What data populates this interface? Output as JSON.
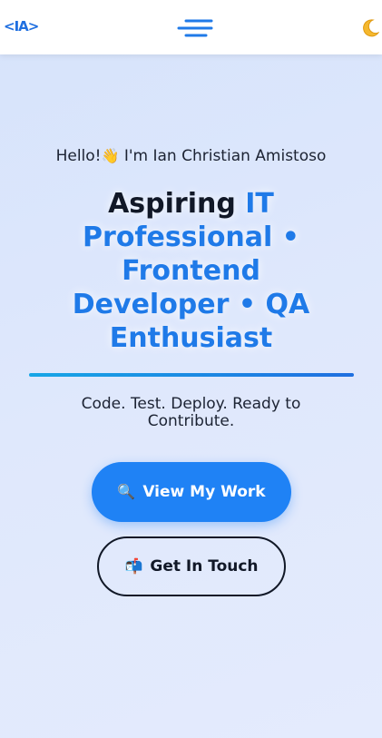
{
  "header": {
    "logo_text": "<IA>",
    "menu_icon": "menu-icon",
    "theme_icon": "moon-icon"
  },
  "hero": {
    "greeting_prefix": "Hello!",
    "greeting_emoji": "👋",
    "greeting_name": "I'm Ian Christian Amistoso",
    "headline_plain": "Aspiring ",
    "headline_accent_1": "IT Professional",
    "headline_accent_2": "• Frontend Developer • QA Enthusiast",
    "tagline": "Code. Test. Deploy. Ready to Contribute."
  },
  "buttons": {
    "primary_icon": "🔍",
    "primary_label": "View My Work",
    "secondary_icon": "📬",
    "secondary_label": "Get In Touch"
  },
  "colors": {
    "accent": "#1f7ae8",
    "primary_button": "#1f82f5",
    "text_dark": "#111827"
  }
}
